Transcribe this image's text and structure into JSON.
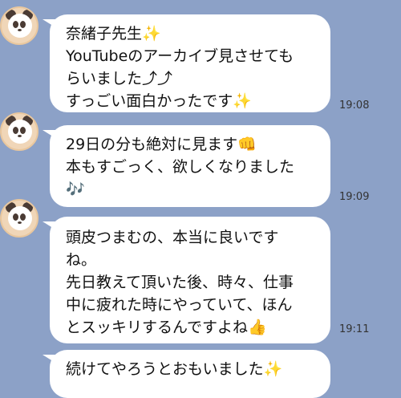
{
  "messages": [
    {
      "lines": [
        "奈緒子先生✨",
        "YouTubeのアーカイブ見させても",
        "らいました⤴︎⤴︎",
        "すっごい面白かったです✨"
      ],
      "time": "19:08"
    },
    {
      "lines": [
        "29日の分も絶対に見ます👊",
        "本もすごっく、欲しくなりました",
        "🎶"
      ],
      "time": "19:09"
    },
    {
      "lines": [
        "頭皮つまむの、本当に良いです",
        "ね。",
        "先日教えて頂いた後、時々、仕事",
        "中に疲れた時にやっていて、ほん",
        "とスッキリするんですよね👍"
      ],
      "time": "19:11"
    },
    {
      "lines": [
        "続けてやろうとおもいました✨"
      ],
      "time": ""
    }
  ],
  "colors": {
    "background": "#8ca1c7",
    "bubble": "#ffffff"
  }
}
